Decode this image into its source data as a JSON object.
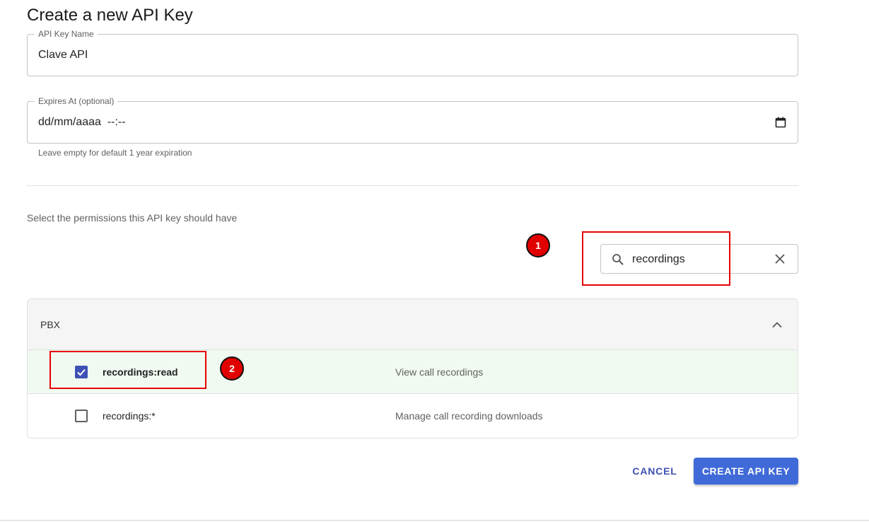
{
  "form": {
    "title": "Create a new API Key",
    "name_field": {
      "label": "API Key Name",
      "value": "Clave API"
    },
    "expires_field": {
      "label": "Expires At (optional)",
      "value": "dd/mm/aaaa  --:--",
      "helper": "Leave empty for default 1 year expiration"
    },
    "permissions_intro": "Select the permissions this API key should have"
  },
  "search": {
    "value": "recordings"
  },
  "panel": {
    "title": "PBX",
    "permissions": [
      {
        "name": "recordings:read",
        "description": "View call recordings",
        "checked": true
      },
      {
        "name": "recordings:*",
        "description": "Manage call recording downloads",
        "checked": false
      }
    ]
  },
  "actions": {
    "cancel_label": "CANCEL",
    "create_label": "CREATE API KEY"
  },
  "annotations": {
    "badge_1": "1",
    "badge_2": "2"
  },
  "colors": {
    "primary": "#3f51b5",
    "button": "#3f6ad8",
    "annotation": "#e60000",
    "selected_row": "#f1faf1"
  }
}
